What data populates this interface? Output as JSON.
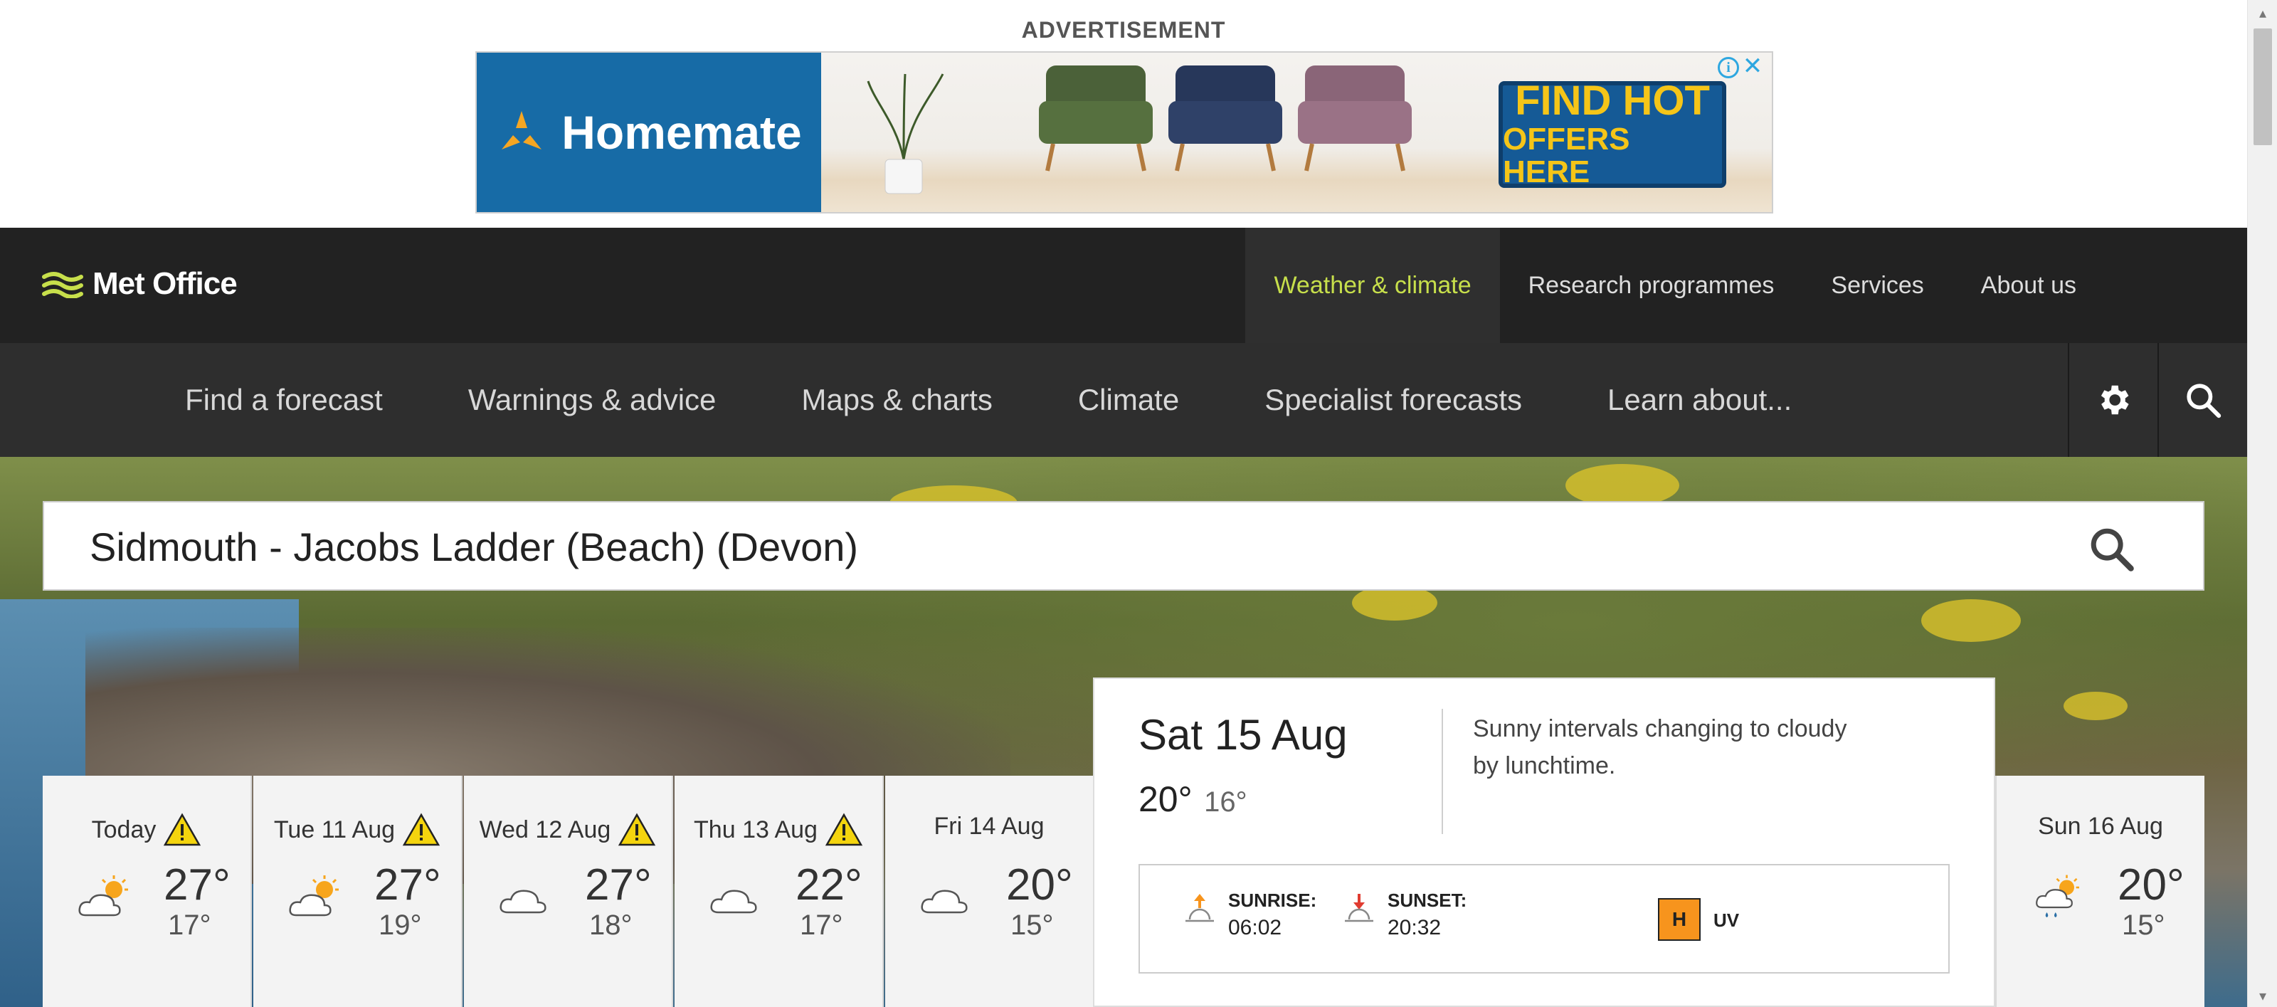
{
  "ad": {
    "label": "ADVERTISEMENT",
    "brand": "Homemate",
    "offer_line1": "FIND HOT",
    "offer_line2": "OFFERS HERE",
    "info_glyph": "i",
    "close_glyph": "✕"
  },
  "topnav": {
    "logo": "Met Office",
    "items": [
      {
        "label": "Weather & climate",
        "active": true
      },
      {
        "label": "Research programmes",
        "active": false
      },
      {
        "label": "Services",
        "active": false
      },
      {
        "label": "About us",
        "active": false
      }
    ],
    "active_color": "#c7df4b"
  },
  "subnav": {
    "items": [
      {
        "label": "Find a forecast"
      },
      {
        "label": "Warnings & advice"
      },
      {
        "label": "Maps & charts"
      },
      {
        "label": "Climate"
      },
      {
        "label": "Specialist forecasts"
      },
      {
        "label": "Learn about..."
      }
    ],
    "icons": [
      "gear-icon",
      "search-icon"
    ]
  },
  "search": {
    "value": "Sidmouth - Jacobs Ladder (Beach) (Devon)"
  },
  "forecast": {
    "days": [
      {
        "name": "Today",
        "warning": true,
        "icon": "sunny-intervals-icon",
        "max": "27°",
        "min": "17°"
      },
      {
        "name": "Tue 11 Aug",
        "warning": true,
        "icon": "sunny-intervals-icon",
        "max": "27°",
        "min": "19°"
      },
      {
        "name": "Wed 12 Aug",
        "warning": true,
        "icon": "cloud-icon",
        "max": "27°",
        "min": "18°"
      },
      {
        "name": "Thu 13 Aug",
        "warning": true,
        "icon": "cloud-icon",
        "max": "22°",
        "min": "17°"
      },
      {
        "name": "Fri 14 Aug",
        "warning": false,
        "icon": "cloud-icon",
        "max": "20°",
        "min": "15°"
      }
    ],
    "selected": {
      "date": "Sat 15 Aug",
      "max": "20°",
      "min": "16°",
      "description": "Sunny intervals changing to cloudy by lunchtime.",
      "sunrise_label": "SUNRISE:",
      "sunrise": "06:02",
      "sunset_label": "SUNSET:",
      "sunset": "20:32",
      "uv_value": "H",
      "uv_label": "UV"
    },
    "after": {
      "name": "Sun 16 Aug",
      "icon": "light-rain-shower-icon",
      "max": "20°",
      "min": "15°"
    }
  },
  "colors": {
    "nav_bg": "#222222",
    "subnav_bg": "#2e2e2e",
    "uv_high": "#f7941d",
    "warning_yellow": "#f4d40e"
  }
}
